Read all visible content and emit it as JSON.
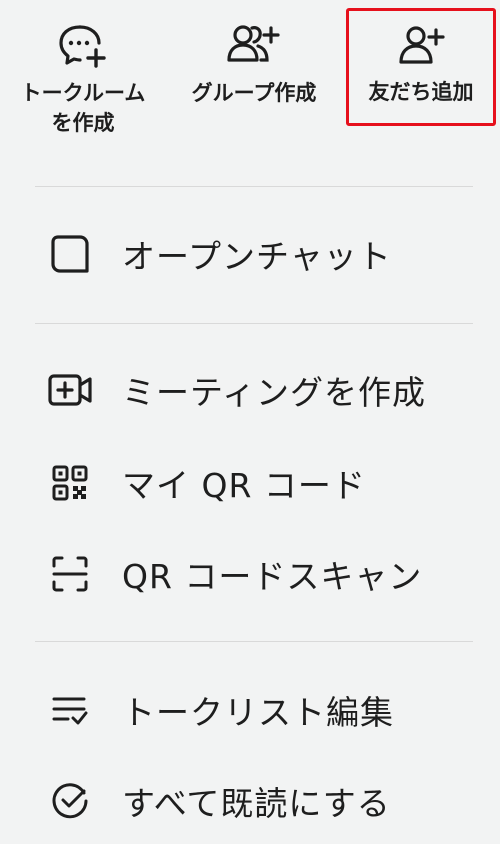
{
  "top_actions": {
    "create_room": {
      "label_line1": "トークルーム",
      "label_line2": "を作成",
      "icon": "chat-bubble-plus-icon"
    },
    "create_group": {
      "label": "グループ作成",
      "icon": "group-plus-icon"
    },
    "add_friends": {
      "label": "友だち追加",
      "icon": "person-plus-icon",
      "highlight_color": "#e6101c"
    }
  },
  "menu": {
    "open_chat": {
      "label": "オープンチャット",
      "icon": "open-chat-icon"
    },
    "create_meeting": {
      "label": "ミーティングを作成",
      "icon": "video-plus-icon"
    },
    "my_qr": {
      "label": "マイ QR コード",
      "icon": "qr-code-icon"
    },
    "qr_scan": {
      "label": "QR コードスキャン",
      "icon": "scan-frame-icon"
    },
    "edit_list": {
      "label": "トークリスト編集",
      "icon": "list-check-icon"
    },
    "mark_read": {
      "label": "すべて既読にする",
      "icon": "check-circle-icon"
    }
  }
}
